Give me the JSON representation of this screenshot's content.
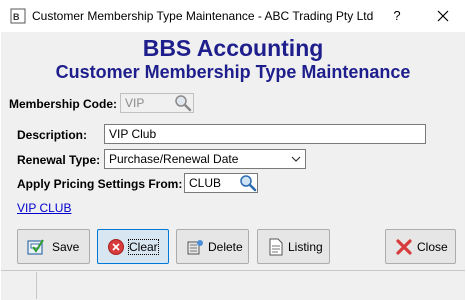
{
  "window": {
    "title": "Customer Membership Type Maintenance - ABC Trading Pty Ltd",
    "help_label": "?",
    "close_icon": "close-icon"
  },
  "header": {
    "app_name": "BBS Accounting",
    "screen_title": "Customer Membership Type Maintenance"
  },
  "form": {
    "membership_code_label": "Membership Code:",
    "membership_code_value": "VIP",
    "description_label": "Description:",
    "description_value": "VIP Club",
    "renewal_type_label": "Renewal Type:",
    "renewal_type_value": "Purchase/Renewal Date",
    "pricing_label": "Apply Pricing Settings From:",
    "pricing_value": "CLUB",
    "link_text": "VIP CLUB"
  },
  "buttons": {
    "save": "Save",
    "clear": "Clear",
    "delete": "Delete",
    "listing": "Listing",
    "close": "Close"
  },
  "colors": {
    "heading": "#1e1e8c",
    "link": "#0000cc",
    "accent": "#0078d7"
  }
}
